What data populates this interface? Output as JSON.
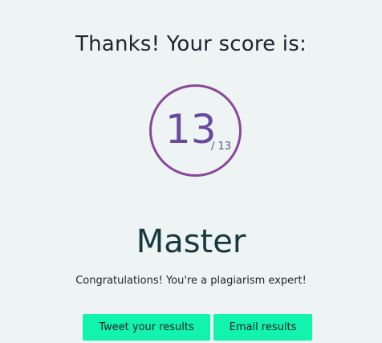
{
  "result": {
    "heading": "Thanks! Your score is:",
    "score": "13",
    "total": "/ 13",
    "rank": "Master",
    "message": "Congratulations! You're a plagiarism expert!"
  },
  "actions": {
    "tweet_label": "Tweet your results",
    "email_label": "Email results"
  },
  "colors": {
    "background": "#eef4f4",
    "ring": "#8b479a",
    "score": "#6a4a9f",
    "rank": "#17383f",
    "button": "#12f3ae"
  }
}
